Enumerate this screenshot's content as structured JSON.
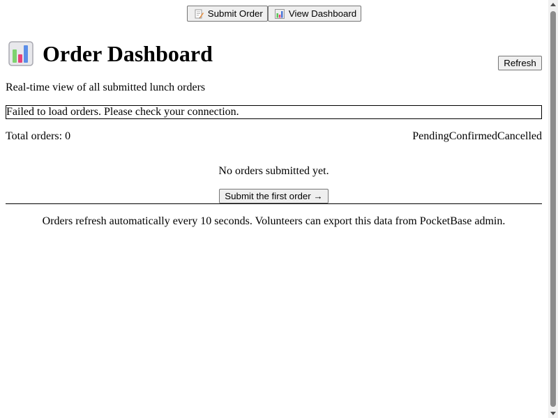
{
  "nav": {
    "submit_order_label": "Submit Order",
    "submit_order_icon": "memo-icon",
    "view_dashboard_label": "View Dashboard",
    "view_dashboard_icon": "bar-chart-icon"
  },
  "header": {
    "title": "Order Dashboard",
    "icon": "bar-chart-icon",
    "refresh_label": "Refresh"
  },
  "main": {
    "subtitle": "Real-time view of all submitted lunch orders",
    "error_message": "Failed to load orders. Please check your connection.",
    "total_orders_text": "Total orders: 0",
    "filters": [
      "Pending",
      "Confirmed",
      "Cancelled"
    ],
    "empty_message": "No orders submitted yet.",
    "first_order_button": "Submit the first order →"
  },
  "footer": {
    "note": "Orders refresh automatically every 10 seconds. Volunteers can export this data from PocketBase admin."
  },
  "colors": {
    "button_bg": "#efefef",
    "button_border": "#767676",
    "text": "#000000"
  }
}
